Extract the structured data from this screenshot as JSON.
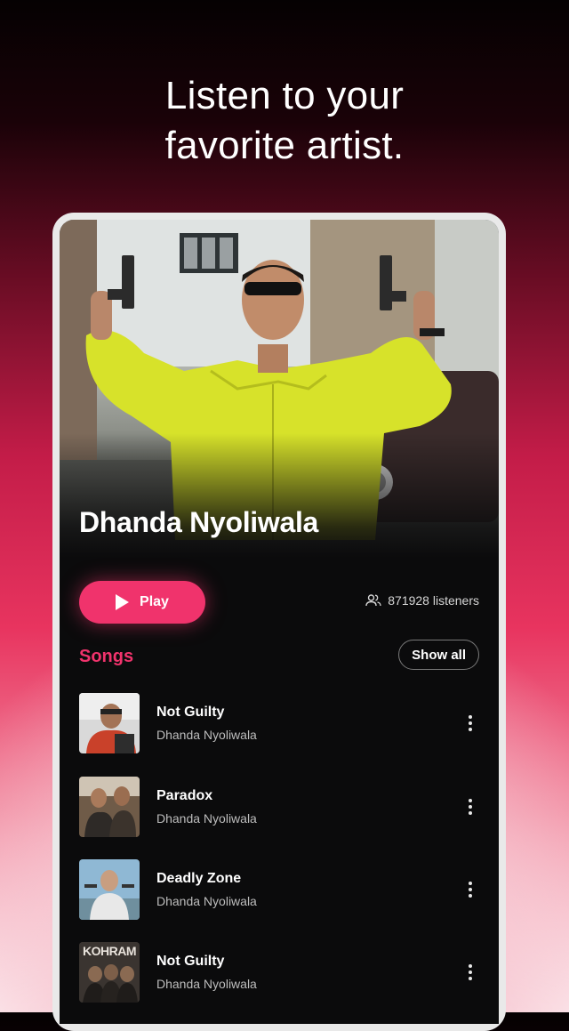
{
  "headline": {
    "line1": "Listen to your",
    "line2": "favorite artist."
  },
  "artist": {
    "name": "Dhanda Nyoliwala",
    "listeners": "871928 listeners"
  },
  "actions": {
    "play_label": "Play"
  },
  "songs_section": {
    "title": "Songs",
    "show_all_label": "Show all"
  },
  "songs": [
    {
      "title": "Not Guilty",
      "artist": "Dhanda Nyoliwala"
    },
    {
      "title": "Paradox",
      "artist": "Dhanda Nyoliwala"
    },
    {
      "title": "Deadly Zone",
      "artist": "Dhanda Nyoliwala"
    },
    {
      "title": "Not Guilty",
      "artist": "Dhanda Nyoliwala",
      "cover_text": "KOHRAM"
    }
  ],
  "colors": {
    "accent": "#f0336c",
    "background": "#0b0b0c"
  }
}
